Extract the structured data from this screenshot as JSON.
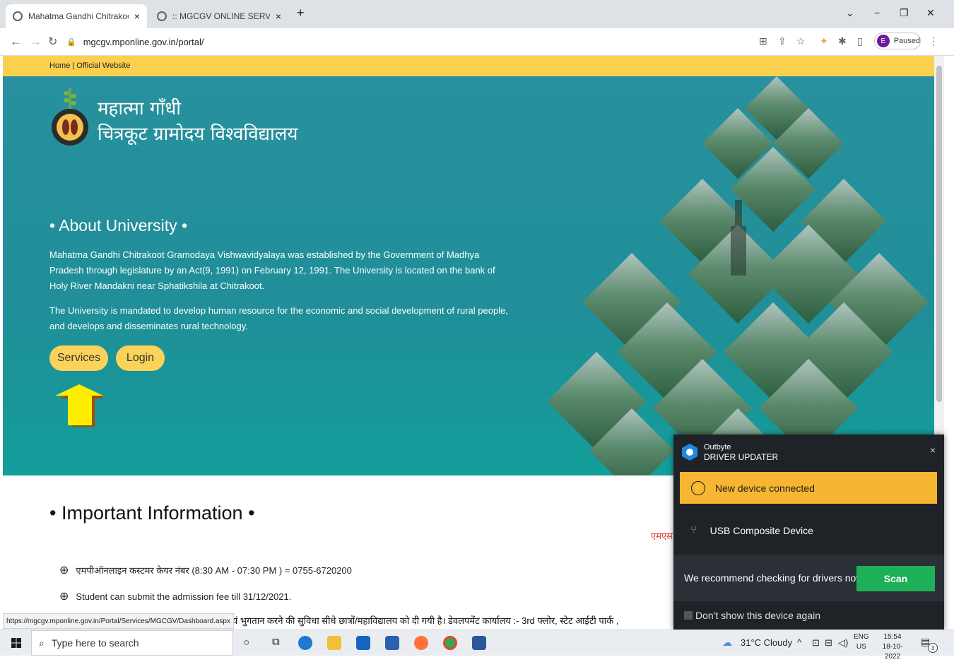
{
  "browser": {
    "tabs": [
      {
        "title": "Mahatma Gandhi Chitrakoot Gra",
        "close": "×"
      },
      {
        "title": ":: MGCGV ONLINE SERVICES ::",
        "close": "×"
      }
    ],
    "new_tab": "+",
    "url": "mgcgv.mponline.gov.in/portal/",
    "profile_initial": "E",
    "profile_status": "Paused"
  },
  "site": {
    "topbar_links": "Home | Official Website",
    "hindi_line1": "महात्मा गाँधी",
    "hindi_line2": "चित्रकूट ग्रामोदय विश्वविद्यालय",
    "about_heading": "• About University •",
    "about_para1": "Mahatma Gandhi Chitrakoot Gramodaya Vishwavidyalaya was established by the Government of Madhya Pradesh through legislature by an Act(9, 1991) on February 12, 1991. The University is located on the bank of Holy River Mandakni near Sphatikshila at Chitrakoot.",
    "about_para2": "The University is mandated to develop human resource for the economic and social development of rural people, and develops and disseminates rural technology.",
    "services_button": "Services",
    "login_button": "Login",
    "info_heading": "• Important Information •",
    "info_items": [
      "एमपीऑनलाइन कस्टमर केयर नंबर (8:30 AM - 07:30 PM ) = 0755-6720200",
      "Student can submit the admission fee till 31/12/2021."
    ],
    "red_ticker": "एमएस",
    "ticker_tail": "वं भुगतान करने की सुविधा सीधे छात्रों/महाविद्यालय को दी गयी है। डेवलपमेंट कार्यालय :- 3rd फ्लोर, स्टेट आईटी पार्क ,"
  },
  "status_url": "https://mgcgv.mponline.gov.in/Portal/Services/MGCGV/Dashboard.aspx",
  "popup": {
    "brand_line1": "Outbyte",
    "brand_line2": "DRIVER UPDATER",
    "close": "×",
    "alert_text": "New device connected",
    "device_name": "USB Composite Device",
    "recommend_text": "We recommend checking for drivers now",
    "scan_button": "Scan",
    "dont_show": "Don't show this device again"
  },
  "taskbar": {
    "search_placeholder": "Type here to search",
    "weather": "31°C  Cloudy",
    "lang_top": "ENG",
    "lang_bottom": "US",
    "time": "15:54",
    "date": "18-10-2022",
    "notif_count": "3"
  }
}
